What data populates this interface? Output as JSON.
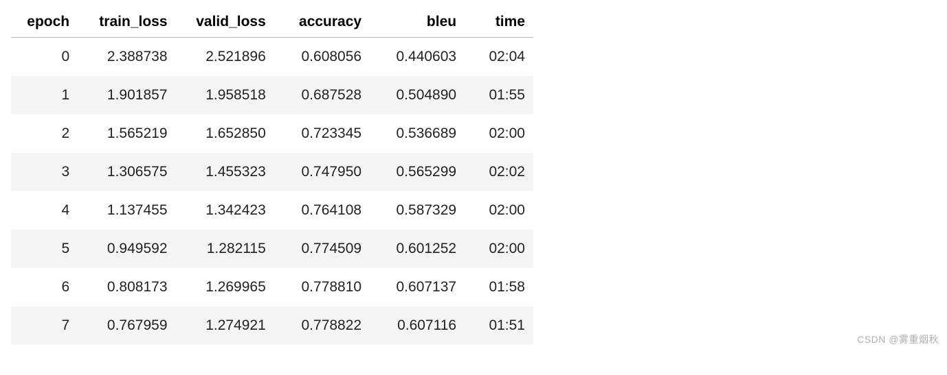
{
  "headers": {
    "epoch": "epoch",
    "train_loss": "train_loss",
    "valid_loss": "valid_loss",
    "accuracy": "accuracy",
    "bleu": "bleu",
    "time": "time"
  },
  "rows": [
    {
      "epoch": "0",
      "train_loss": "2.388738",
      "valid_loss": "2.521896",
      "accuracy": "0.608056",
      "bleu": "0.440603",
      "time": "02:04"
    },
    {
      "epoch": "1",
      "train_loss": "1.901857",
      "valid_loss": "1.958518",
      "accuracy": "0.687528",
      "bleu": "0.504890",
      "time": "01:55"
    },
    {
      "epoch": "2",
      "train_loss": "1.565219",
      "valid_loss": "1.652850",
      "accuracy": "0.723345",
      "bleu": "0.536689",
      "time": "02:00"
    },
    {
      "epoch": "3",
      "train_loss": "1.306575",
      "valid_loss": "1.455323",
      "accuracy": "0.747950",
      "bleu": "0.565299",
      "time": "02:02"
    },
    {
      "epoch": "4",
      "train_loss": "1.137455",
      "valid_loss": "1.342423",
      "accuracy": "0.764108",
      "bleu": "0.587329",
      "time": "02:00"
    },
    {
      "epoch": "5",
      "train_loss": "0.949592",
      "valid_loss": "1.282115",
      "accuracy": "0.774509",
      "bleu": "0.601252",
      "time": "02:00"
    },
    {
      "epoch": "6",
      "train_loss": "0.808173",
      "valid_loss": "1.269965",
      "accuracy": "0.778810",
      "bleu": "0.607137",
      "time": "01:58"
    },
    {
      "epoch": "7",
      "train_loss": "0.767959",
      "valid_loss": "1.274921",
      "accuracy": "0.778822",
      "bleu": "0.607116",
      "time": "01:51"
    }
  ],
  "watermark": "CSDN @雾重烟秋",
  "chart_data": {
    "type": "table",
    "title": "",
    "columns": [
      "epoch",
      "train_loss",
      "valid_loss",
      "accuracy",
      "bleu",
      "time"
    ],
    "x": [
      0,
      1,
      2,
      3,
      4,
      5,
      6,
      7
    ],
    "series": [
      {
        "name": "train_loss",
        "values": [
          2.388738,
          1.901857,
          1.565219,
          1.306575,
          1.137455,
          0.949592,
          0.808173,
          0.767959
        ]
      },
      {
        "name": "valid_loss",
        "values": [
          2.521896,
          1.958518,
          1.65285,
          1.455323,
          1.342423,
          1.282115,
          1.269965,
          1.274921
        ]
      },
      {
        "name": "accuracy",
        "values": [
          0.608056,
          0.687528,
          0.723345,
          0.74795,
          0.764108,
          0.774509,
          0.77881,
          0.778822
        ]
      },
      {
        "name": "bleu",
        "values": [
          0.440603,
          0.50489,
          0.536689,
          0.565299,
          0.587329,
          0.601252,
          0.607137,
          0.607116
        ]
      }
    ],
    "time": [
      "02:04",
      "01:55",
      "02:00",
      "02:02",
      "02:00",
      "02:00",
      "01:58",
      "01:51"
    ]
  }
}
